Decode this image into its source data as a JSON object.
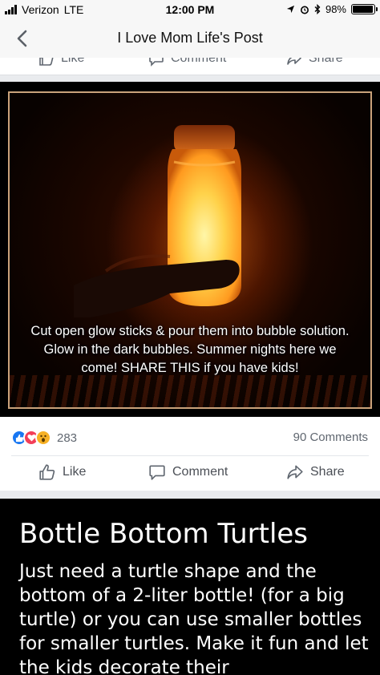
{
  "status_bar": {
    "carrier": "Verizon",
    "network": "LTE",
    "time": "12:00 PM",
    "battery": "98%",
    "battery_level": 0.98
  },
  "nav": {
    "title": "I Love Mom Life's Post"
  },
  "prev_post": {
    "like_label": "Like",
    "comment_label": "Comment",
    "share_label": "Share"
  },
  "post": {
    "image_caption": "Cut open glow sticks & pour them into bubble solution. Glow in the dark bubbles. Summer nights here we come! SHARE THIS if you have kids!",
    "reaction_count": "283",
    "comments_count": "90 Comments",
    "like_label": "Like",
    "comment_label": "Comment",
    "share_label": "Share"
  },
  "next_post": {
    "title": "Bottle Bottom Turtles",
    "body": "Just need a turtle shape and the bottom of a 2-liter bottle! (for a big turtle) or you can use smaller bottles for smaller turtles. Make it fun and let the kids decorate their"
  },
  "colors": {
    "like_blue": "#1877f2",
    "love_red": "#f33e58",
    "wow_yellow": "#f7b125",
    "glow_orange": "#ff9a1f"
  }
}
